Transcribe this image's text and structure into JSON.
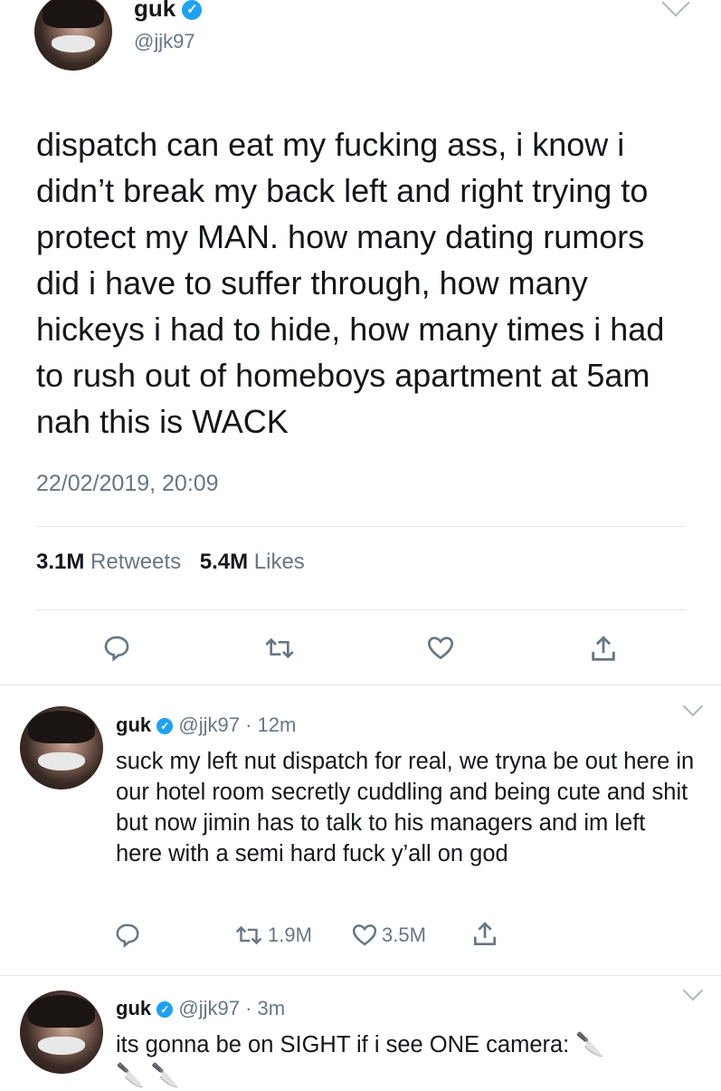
{
  "main_tweet": {
    "display_name": "guk",
    "handle": "@jjk97",
    "text": "dispatch can eat my fucking ass, i know i didn’t break my back left and right trying to protect my MAN. how many dating rumors did i have to suffer through, how many hickeys i had to hide, how many times i had to rush out of homeboys apartment at 5am nah this is WACK",
    "timestamp": "22/02/2019, 20:09",
    "retweets_count": "3.1M",
    "retweets_label": "Retweets",
    "likes_count": "5.4M",
    "likes_label": "Likes"
  },
  "reply1": {
    "display_name": "guk",
    "handle": "@jjk97",
    "separator": "·",
    "time": "12m",
    "text": "suck my left nut dispatch for real, we tryna be out here in our hotel room secretly cuddling and being cute and shit but now jimin has to talk to his managers and im left here with a semi hard fuck y’all on god",
    "retweets": "1.9M",
    "likes": "3.5M"
  },
  "reply2": {
    "display_name": "guk",
    "handle": "@jjk97",
    "separator": "·",
    "time": "3m",
    "text": "its gonna be on SIGHT if i see ONE camera:",
    "emoji": "🔪",
    "emoji_line": "🔪 🔪"
  },
  "icons": {
    "verified": "verified-badge-icon",
    "reply": "speech-bubble-icon",
    "retweet": "retweet-arrows-icon",
    "like": "heart-icon",
    "share": "share-upload-icon",
    "menu": "chevron-down-icon"
  },
  "colors": {
    "text": "#14171a",
    "secondary": "#657786",
    "verified": "#1da1f2",
    "divider": "#e1e8ed"
  }
}
